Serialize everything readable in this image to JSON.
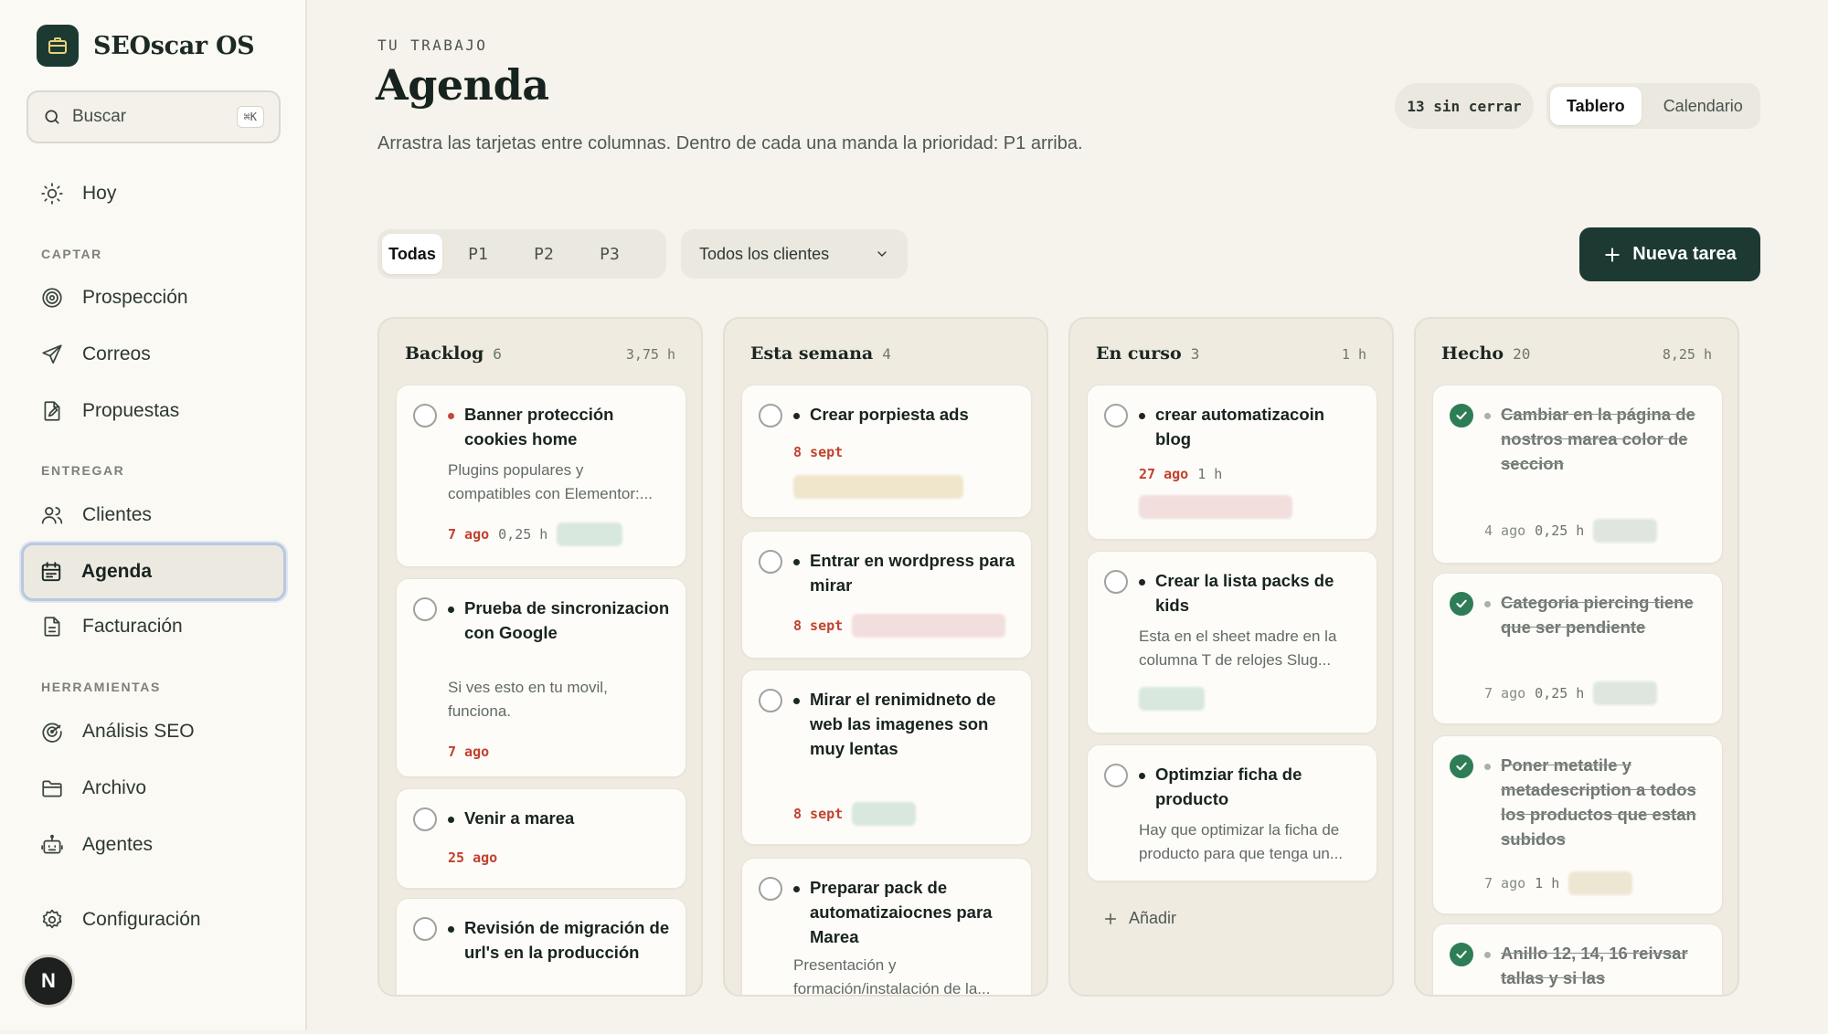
{
  "app": {
    "name": "SEOscar OS"
  },
  "search": {
    "label": "Buscar",
    "shortcut": "⌘K"
  },
  "nav": {
    "today": "Hoy",
    "sections": {
      "capture": "CAPTAR",
      "deliver": "ENTREGAR",
      "tools": "HERRAMIENTAS"
    },
    "prospecting": "Prospección",
    "emails": "Correos",
    "proposals": "Propuestas",
    "clients": "Clientes",
    "agenda": "Agenda",
    "billing": "Facturación",
    "seo": "Análisis SEO",
    "archive": "Archivo",
    "agents": "Agentes",
    "settings": "Configuración"
  },
  "user": {
    "initial": "N"
  },
  "header": {
    "eyebrow": "TU TRABAJO",
    "title": "Agenda",
    "subtitle": "Arrastra las tarjetas entre columnas. Dentro de cada una manda la prioridad: P1 arriba.",
    "open_count": "13 sin cerrar",
    "views": [
      "Tablero",
      "Calendario"
    ]
  },
  "filters": {
    "priorities": [
      "Todas",
      "P1",
      "P2",
      "P3"
    ],
    "client_select": "Todos los clientes",
    "new_task": "Nueva tarea"
  },
  "columns": [
    {
      "title": "Backlog",
      "count": "6",
      "hours": "3,75 h",
      "cards": [
        {
          "title": "Banner protección cookies home",
          "desc": "Plugins populares y compatibles con Elementor:...",
          "date": "7 ago",
          "hours": "0,25 h"
        },
        {
          "title": "Prueba de sincronizacion con Google",
          "desc": "Si ves esto en tu movil, funciona.",
          "date": "7 ago"
        },
        {
          "title": "Venir a marea",
          "date": "25 ago"
        },
        {
          "title": "Revisión de migración de url's en la producción"
        }
      ]
    },
    {
      "title": "Esta semana",
      "count": "4",
      "cards": [
        {
          "title": "Crear porpiesta ads",
          "date": "8 sept"
        },
        {
          "title": "Entrar en wordpress para mirar",
          "date": "8 sept"
        },
        {
          "title": "Mirar el renimidneto de web las imagenes son muy lentas",
          "date": "8 sept"
        },
        {
          "title": "Preparar pack de automatizaiocnes para Marea",
          "desc": "Presentación y formación/instalación de la..."
        }
      ]
    },
    {
      "title": "En curso",
      "count": "3",
      "hours": "1 h",
      "cards": [
        {
          "title": "crear automatizacoin blog",
          "date": "27 ago",
          "hours": "1 h"
        },
        {
          "title": "Crear la lista packs de kids",
          "desc": "Esta en el sheet madre en la columna T de relojes Slug..."
        },
        {
          "title": "Optimziar ficha de producto",
          "desc": "Hay que optimizar la ficha de producto para que tenga un..."
        }
      ],
      "add_label": "Añadir"
    },
    {
      "title": "Hecho",
      "count": "20",
      "hours": "8,25 h",
      "cards": [
        {
          "title": "Cambiar en la página de nostros marea color de seccion",
          "date": "4 ago",
          "hours": "0,25 h"
        },
        {
          "title": "Categoria piercing tiene que ser pendiente",
          "date": "7 ago",
          "hours": "0,25 h"
        },
        {
          "title": "Poner metatile y metadescription a todos los productos que estan subidos",
          "date": "7 ago",
          "hours": "1 h"
        },
        {
          "title": "Anillo 12, 14, 16 reivsar tallas y si las"
        }
      ]
    }
  ],
  "colors": {
    "brand": "#1c3a32",
    "background": "#f6f3ec",
    "column": "#efebe1",
    "date_due": "#c2412f",
    "done_check": "#2f7d57"
  }
}
